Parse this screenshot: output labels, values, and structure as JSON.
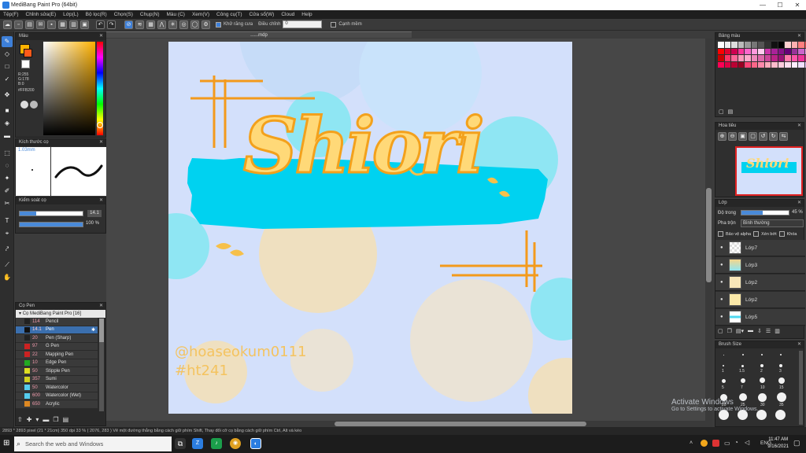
{
  "window": {
    "title": "MediBang Paint Pro (64bit)",
    "minimize": "—",
    "maximize": "☐",
    "close": "✕"
  },
  "menu": [
    "Tệp(F)",
    "Chỉnh sửa(E)",
    "Lớp(L)",
    "Bộ lọc(R)",
    "Chọn(S)",
    "Chụp(N)",
    "Màu (C)",
    "Xem(V)",
    "Công cụ(T)",
    "Cửa sổ(W)",
    "Cloud",
    "Help"
  ],
  "toolbar": {
    "antialias_label": "Khử răng cưa",
    "correction_label": "Điều chỉnh",
    "correction_value": "0",
    "edge_label": "Cạnh mềm"
  },
  "document_tab": "......mdp",
  "panels": {
    "color": {
      "title": "Màu",
      "r": "R:255",
      "g": "G:178",
      "b": "B:0",
      "hex": "#FFB200"
    },
    "brush_size": {
      "title": "Kích thước cọ",
      "size_label": "1.03mm"
    },
    "brush_control": {
      "title": "Kiểm soát cọ",
      "size_value": "14.1",
      "opacity_value": "100 %"
    },
    "brushes": {
      "title": "Cọ Pen",
      "group": "Cọ MediBang Paint Pro [16]",
      "items": [
        {
          "num": "114",
          "name": "Pencil",
          "color": "#222222"
        },
        {
          "num": "14.1",
          "name": "Pen",
          "color": "#111111"
        },
        {
          "num": "20",
          "name": "Pen (Sharp)",
          "color": "#222222"
        },
        {
          "num": "97",
          "name": "G Pen",
          "color": "#cc2222"
        },
        {
          "num": "22",
          "name": "Mapping Pen",
          "color": "#cc2222"
        },
        {
          "num": "10",
          "name": "Edge Pen",
          "color": "#22aa22"
        },
        {
          "num": "50",
          "name": "Stipple Pen",
          "color": "#dddd22"
        },
        {
          "num": "357",
          "name": "Sumi",
          "color": "#d0d020"
        },
        {
          "num": "50",
          "name": "Watercolor",
          "color": "#55ccee"
        },
        {
          "num": "600",
          "name": "Watercolor (Wet)",
          "color": "#55ccee"
        },
        {
          "num": "650",
          "name": "Acrylic",
          "color": "#dd8822"
        }
      ]
    },
    "palette": {
      "title": "Bảng màu"
    },
    "navigator": {
      "title": "Hoa tiêu"
    },
    "layer": {
      "title": "Lớp",
      "opacity_label": "Độ trong",
      "opacity_value": "45 %",
      "blend_label": "Pha trộn",
      "blend_value": "Bình thường",
      "protect_alpha": "Bảo vệ alpha",
      "clipping": "Xén bớt",
      "lock": "Khóa",
      "layers": [
        "Lớp7",
        "Lớp3",
        "Lớp2",
        "Lớp2",
        "Lớp5"
      ]
    },
    "brush_size_panel": {
      "title": "Brush Size",
      "labels": [
        "1",
        "1.5",
        "2",
        "3",
        "5",
        "7",
        "10",
        "15",
        "20",
        "25",
        "30",
        "35"
      ]
    }
  },
  "artwork": {
    "title_text": "Shiori",
    "watermark_line1": "@hoaseokum0111",
    "watermark_line2": "#ht241"
  },
  "statusbar": "2893 * 2893 pixel  (21 * 21cm)  350 dpi  33 %  ( 2076, 283 )  Vẽ một đường thẳng bằng cách giữ phím Shift, Thay đổi cỡ cọ bằng cách giữ phím Ctrl, Alt và kéo",
  "activation": {
    "title": "Activate Windows",
    "subtitle": "Go to Settings to activate Windows."
  },
  "taskbar": {
    "search_placeholder": "Search the web and Windows",
    "lang": "ENG",
    "time": "11:47 AM",
    "date": "9/16/2021"
  },
  "colors": {
    "accent": "#3d7fd8",
    "canvas_bg": "#d3e0fb",
    "foreground": "#FFB200",
    "secondary": "#ffffff"
  }
}
